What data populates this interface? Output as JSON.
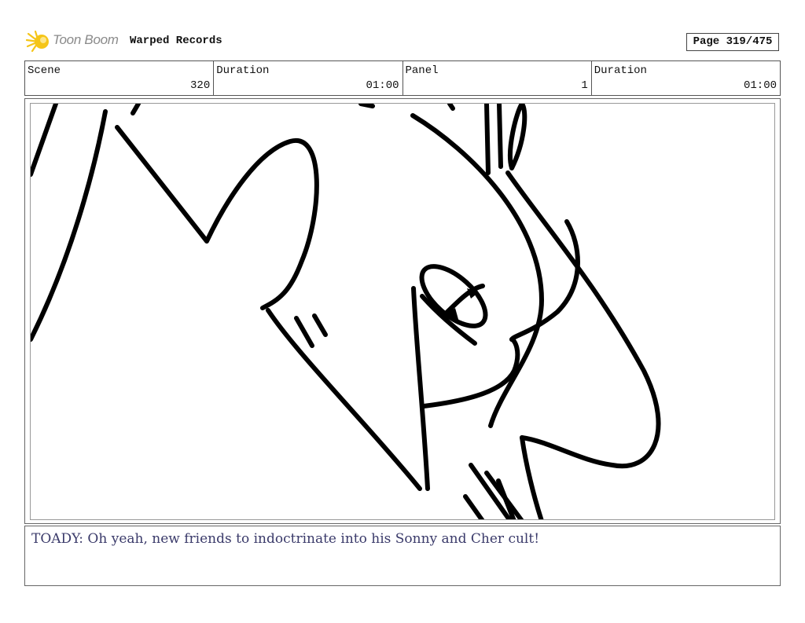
{
  "header": {
    "logo_text": "Toon Boom",
    "project_title": "Warped Records",
    "page_label": "Page 319/475"
  },
  "info": {
    "scene_label": "Scene",
    "scene_value": "320",
    "scene_duration_label": "Duration",
    "scene_duration_value": "01:00",
    "panel_label": "Panel",
    "panel_value": "1",
    "panel_duration_label": "Duration",
    "panel_duration_value": "01:00"
  },
  "dialog": {
    "text": "TOADY: Oh yeah, new friends to indoctrinate into his Sonny and Cher cult!"
  },
  "colors": {
    "logo_accent": "#f5c518",
    "dialog_text": "#3a3a6a"
  }
}
